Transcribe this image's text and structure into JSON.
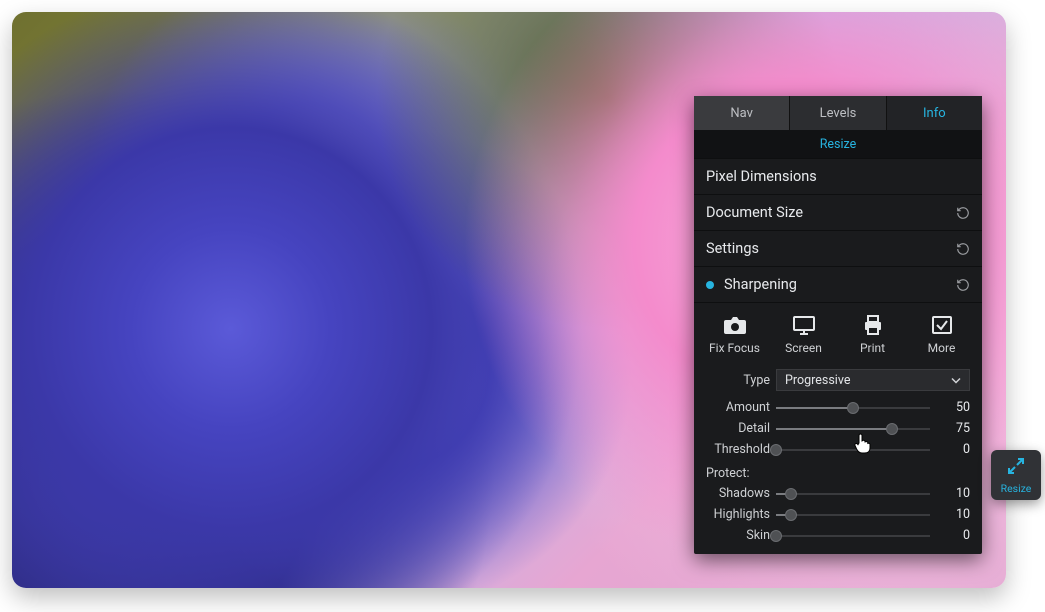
{
  "panel": {
    "tabs": {
      "nav": "Nav",
      "levels": "Levels",
      "info": "Info",
      "active": "info"
    },
    "header": "Resize",
    "sections": [
      {
        "label": "Pixel Dimensions",
        "reset": false
      },
      {
        "label": "Document Size",
        "reset": true
      },
      {
        "label": "Settings",
        "reset": true
      },
      {
        "label": "Sharpening",
        "reset": true,
        "bullet": true
      }
    ],
    "presets": [
      {
        "name": "fix-focus",
        "label": "Fix Focus",
        "icon": "camera-icon"
      },
      {
        "name": "screen",
        "label": "Screen",
        "icon": "monitor-icon"
      },
      {
        "name": "print",
        "label": "Print",
        "icon": "printer-icon"
      },
      {
        "name": "more",
        "label": "More",
        "icon": "check-box-icon"
      }
    ],
    "type": {
      "label": "Type",
      "value": "Progressive"
    },
    "sliders_a": [
      {
        "key": "amount",
        "label": "Amount",
        "value": 50,
        "max": 100
      },
      {
        "key": "detail",
        "label": "Detail",
        "value": 75,
        "max": 100
      },
      {
        "key": "threshold",
        "label": "Threshold",
        "value": 0,
        "max": 100
      }
    ],
    "protect_label": "Protect:",
    "sliders_b": [
      {
        "key": "shadows",
        "label": "Shadows",
        "value": 10,
        "max": 100
      },
      {
        "key": "highlights",
        "label": "Highlights",
        "value": 10,
        "max": 100
      },
      {
        "key": "skin",
        "label": "Skin",
        "value": 0,
        "max": 100
      }
    ]
  },
  "chip": {
    "label": "Resize"
  },
  "colors": {
    "accent": "#27b4e0"
  }
}
